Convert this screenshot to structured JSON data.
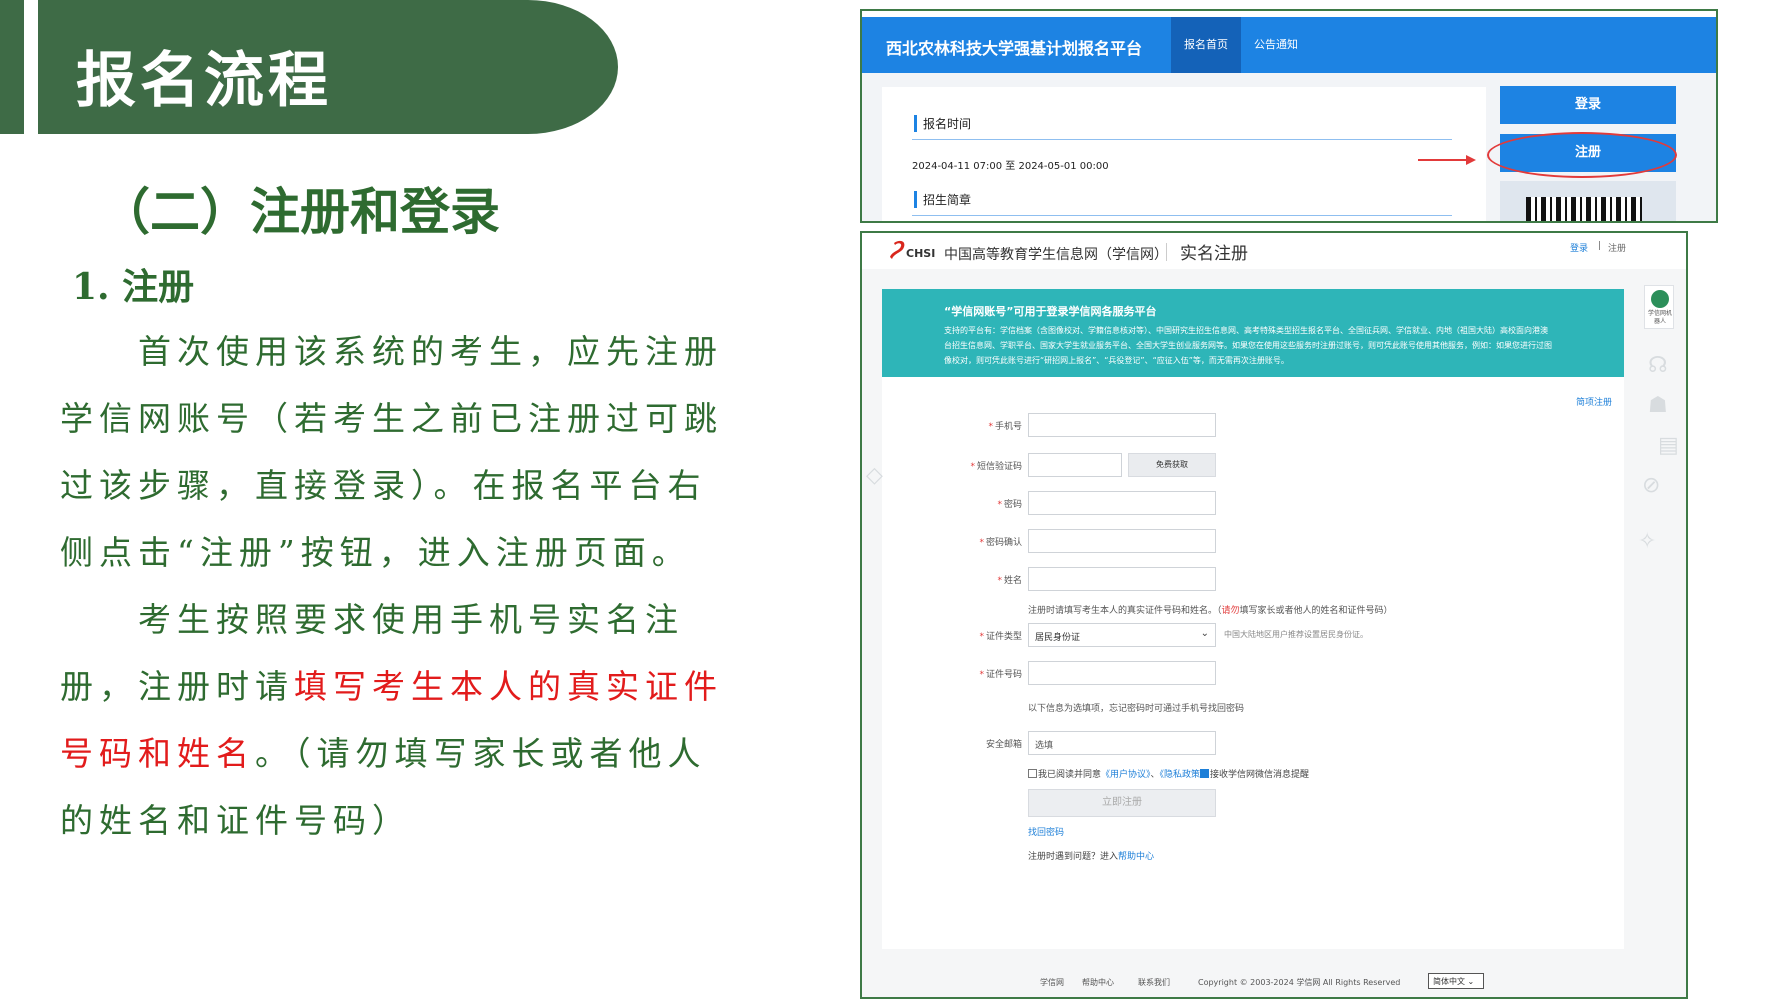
{
  "slide": {
    "title": "报名流程",
    "subtitle": "（二）注册和登录",
    "section": "1. 注册",
    "para1": "首次使用该系统的考生，应先注册学信网账号（若考生之前已注册过可跳过该步骤，直接登录）。在报名平台右侧点击“注册”按钮，进入注册页面。",
    "para2_a": "考生按照要求使用手机号实名注册，注册时请",
    "para2_red": "填写考生本人的真实证件号码和姓名",
    "para2_b": "。（请勿填写家长或者他人的姓名和证件号码）"
  },
  "platform": {
    "brand": "西北农林科技大学强基计划报名平台",
    "nav_home": "报名首页",
    "nav_notice": "公告通知",
    "section_time": "报名时间",
    "time_value": "2024-04-11 07:00 至 2024-05-01 00:00",
    "section_guide": "招生简章",
    "login_btn": "登录",
    "register_btn": "注册"
  },
  "chsi": {
    "logo_text": "CHSI",
    "site_name": "中国高等教育学生信息网（学信网）",
    "page_name": "实名注册",
    "top_login": "登录",
    "top_sep": "|",
    "top_register": "注册",
    "banner_title": "“学信网账号”可用于登录学信网各服务平台",
    "banner_text": "支持的平台有：学信档案（含图像校对、学籍信息核对等）、中国研究生招生信息网、高考特殊类型招生报名平台、全国征兵网、学信就业、内地（祖国大陆）高校面向港澳台招生信息网、学职平台、国家大学生就业服务平台、全国大学生创业服务网等。如果您在使用这些服务时注册过账号，则可凭此账号使用其他服务，例如：如果您进行过图像校对，则可凭此账号进行“研招网上报名”、“兵役登记”、“应征入伍”等，而无需再次注册账号。",
    "simple_register": "简项注册",
    "star": "*",
    "label_phone": "手机号",
    "label_sms": "短信验证码",
    "btn_free_code": "免费获取",
    "label_password": "密码",
    "label_password_confirm": "密码确认",
    "label_name": "姓名",
    "note_real_a": "注册时请填写考生本人的真实证件号码和姓名。（",
    "note_real_warn": "请勿",
    "note_real_b": "填写家长或者他人的姓名和证件号码）",
    "label_id_type": "证件类型",
    "id_type_value": "居民身份证",
    "id_type_hint": "中国大陆地区用户推荐设置居民身份证。",
    "label_id_number": "证件号码",
    "optional_note": "以下信息为选填项，忘记密码时可通过手机号找回密码",
    "label_email": "安全邮箱",
    "email_placeholder": "选填",
    "agree_a": "我已阅读并同意",
    "agree_user": "《用户协议》",
    "agree_sep": "、",
    "agree_privacy": "《隐私政策》",
    "wechat_opt": "接收学信网微信消息提醒",
    "submit_btn": "立即注册",
    "find_password": "找回密码",
    "help_a": "注册时遇到问题？进入",
    "help_link": "帮助中心",
    "robot_text": "学信网机器人",
    "footer_xxw": "学信网",
    "footer_help": "帮助中心",
    "footer_contact": "联系我们",
    "footer_copyright": "Copyright © 2003-2024 学信网 All Rights Reserved",
    "footer_lang": "简体中文"
  },
  "colors": {
    "slide_green": "#3e6b46",
    "text_green": "#2e6b30",
    "highlight_red": "#e21b1b",
    "platform_blue": "#1d83e3",
    "chsi_teal": "#2eb5b8"
  }
}
